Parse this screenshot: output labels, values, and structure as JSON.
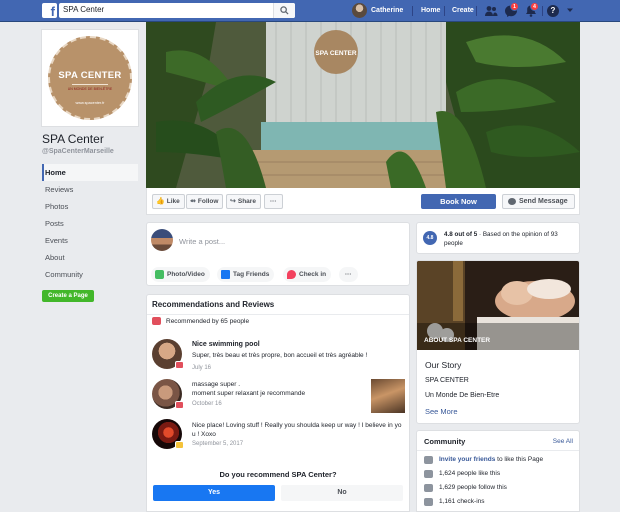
{
  "topbar": {
    "logo": "f",
    "search_value": "SPA Center",
    "user_name": "Catherine",
    "links": [
      "Home",
      "Create"
    ],
    "badges": {
      "messages": "1",
      "notifications": "4"
    },
    "help": "?"
  },
  "profile": {
    "logo_title": "SPA CENTER",
    "logo_subtitle": "UN MONDE DE BIEN-ÊTRE",
    "logo_url": "www.spacenter.fr",
    "page_name": "SPA Center",
    "handle": "@SpaCenterMarseille",
    "create_page_label": "Create a Page"
  },
  "nav": {
    "items": [
      "Home",
      "Reviews",
      "Photos",
      "Posts",
      "Events",
      "About",
      "Community"
    ]
  },
  "cover": {
    "sign_text": "SPA CENTER"
  },
  "action_bar": {
    "like": "Like",
    "follow": "Follow",
    "share": "Share",
    "more": "···",
    "book": "Book Now",
    "send": "Send Message"
  },
  "composer": {
    "placeholder": "Write a post...",
    "photo_video": "Photo/Video",
    "tag_friends": "Tag Friends",
    "check_in": "Check in",
    "more": "···"
  },
  "recommendations": {
    "title": "Recommendations and Reviews",
    "summary": "Recommended by 65 people",
    "reviews": [
      {
        "title": "Nice swimming pool",
        "text": "Super, très beau et très propre, bon accueil et très agréable !",
        "date": "July 16"
      },
      {
        "line1": "massage super .",
        "line2": "moment super relaxant je recommande",
        "date": "October 16"
      },
      {
        "line1": "Nice place! Loving stuff ! Really you shoulda keep ur way ! I believe in yo",
        "line2": "u ! Xoxo",
        "date": "September 5, 2017"
      }
    ],
    "question": "Do you recommend SPA Center?",
    "yes": "Yes",
    "no": "No"
  },
  "rating": {
    "badge": "4.8",
    "score": "4.8 out of 5",
    "based_on": " · Based on the opinion of 93 people"
  },
  "about": {
    "image_label": "ABOUT SPA CENTER",
    "story_title": "Our Story",
    "line1": "SPA CENTER",
    "line2": "Un Monde De Bien-Etre",
    "see_more": "See More"
  },
  "community": {
    "title": "Community",
    "see_all": "See All",
    "invite_link": "Invite your friends",
    "invite_rest": " to like this Page",
    "likes": "1,624 people like this",
    "follows": "1,629 people follow this",
    "checkins": "1,161 check-ins"
  },
  "colors": {
    "facebook_blue": "#4267b2",
    "button_blue": "#1877f2",
    "green": "#42b72a",
    "link": "#385898",
    "badge_red": "#fa3e3e"
  }
}
